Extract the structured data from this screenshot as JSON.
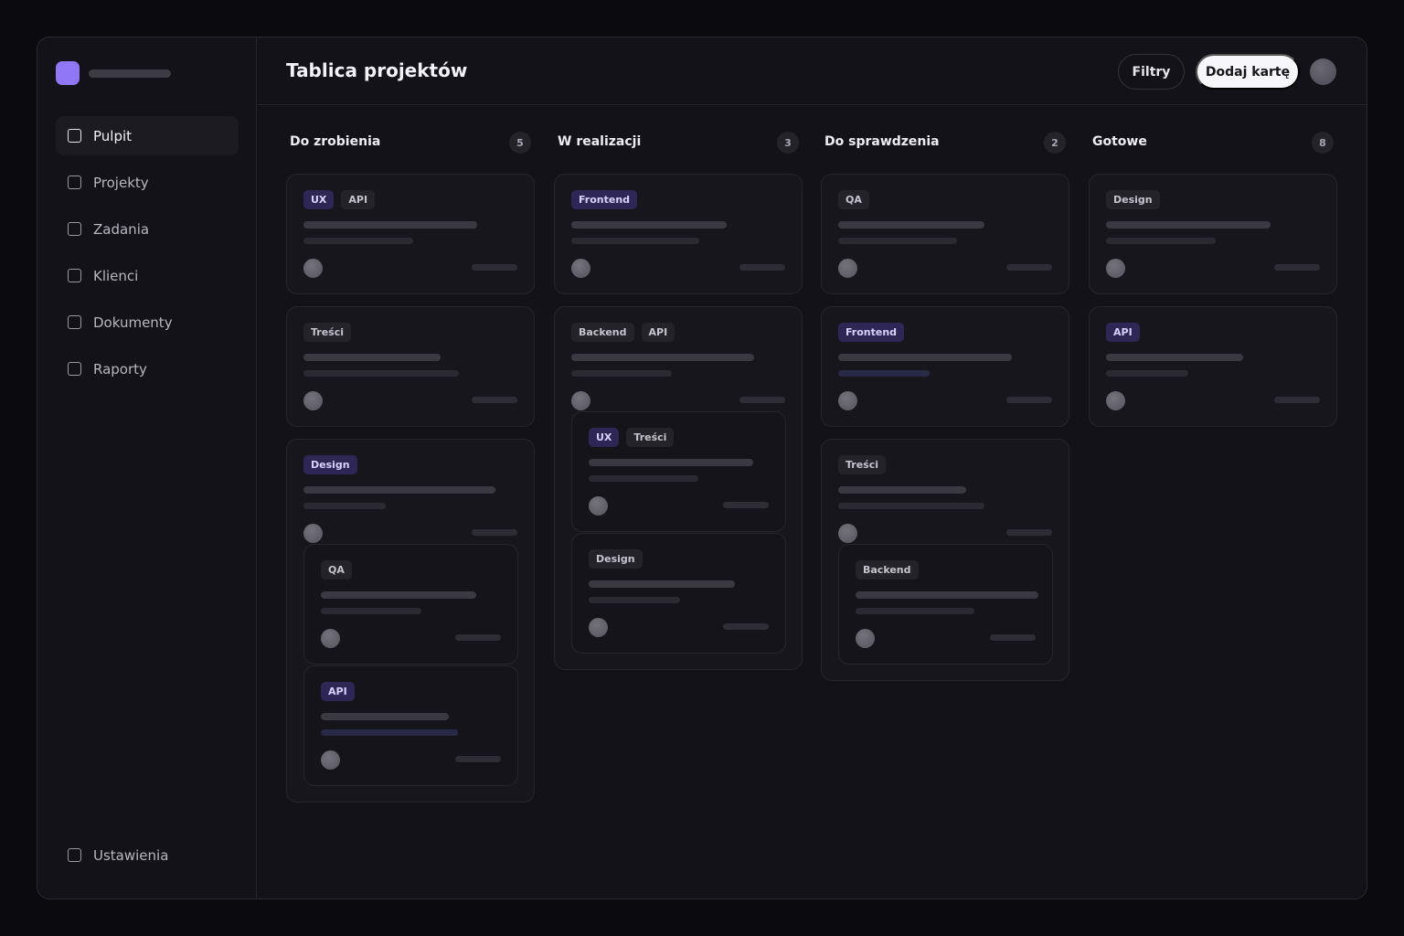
{
  "sidebar": {
    "items": [
      {
        "label": "Pulpit",
        "icon": "checkbox-icon",
        "active": true
      },
      {
        "label": "Projekty",
        "icon": "checkbox-icon"
      },
      {
        "label": "Zadania",
        "icon": "checkbox-icon"
      },
      {
        "label": "Klienci",
        "icon": "checkbox-icon"
      },
      {
        "label": "Dokumenty",
        "icon": "checkbox-icon"
      },
      {
        "label": "Raporty",
        "icon": "checkbox-icon"
      }
    ],
    "settings": {
      "label": "Ustawienia",
      "icon": "checkbox-icon"
    }
  },
  "header": {
    "title": "Tablica projektów",
    "filters_label": "Filtry",
    "add_label": "Dodaj kartę"
  },
  "colors": {
    "brand": "#8f77f5",
    "tag_accent_bg": "#2e2654",
    "background": "#131218"
  },
  "columns": [
    {
      "title": "Do zrobienia",
      "count": "5",
      "cards": [
        [
          "UX",
          "API"
        ],
        [
          "Treści"
        ],
        [
          "Design"
        ],
        [
          "QA"
        ],
        [
          "API"
        ]
      ]
    },
    {
      "title": "W realizacji",
      "count": "3",
      "cards": [
        [
          "Frontend"
        ],
        [
          "Backend",
          "API"
        ],
        [
          "UX",
          "Treści"
        ],
        [
          "Design"
        ]
      ]
    },
    {
      "title": "Do sprawdzenia",
      "count": "2",
      "cards": [
        [
          "QA"
        ],
        [
          "Frontend"
        ],
        [
          "Treści"
        ],
        [
          "Backend"
        ]
      ]
    },
    {
      "title": "Gotowe",
      "count": "8",
      "cards": [
        [
          "Design"
        ],
        [
          "API"
        ]
      ]
    }
  ]
}
